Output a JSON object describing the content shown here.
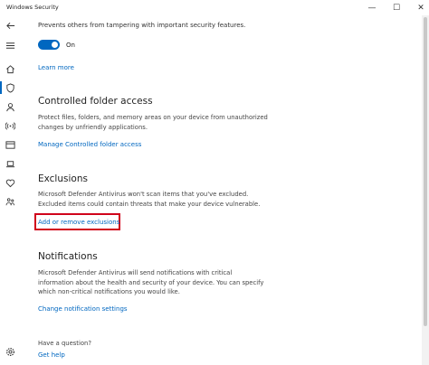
{
  "window": {
    "title": "Windows Security",
    "minimize": "—",
    "maximize": "☐",
    "close": "✕"
  },
  "tamper": {
    "text": "Prevents others from tampering with important security features.",
    "toggle_state": "On",
    "learn_more": "Learn more"
  },
  "controlled_folder": {
    "heading": "Controlled folder access",
    "line1": "Protect files, folders, and memory areas on your device from unauthorized",
    "line2": "changes by unfriendly applications.",
    "link": "Manage Controlled folder access"
  },
  "exclusions": {
    "heading": "Exclusions",
    "line1": "Microsoft Defender Antivirus won't scan items that you've excluded.",
    "line2": "Excluded items could contain threats that make your device vulnerable.",
    "link": "Add or remove exclusions"
  },
  "notifications": {
    "heading": "Notifications",
    "line1": "Microsoft Defender Antivirus will send notifications with critical",
    "line2": "information about the health and security of your device. You can specify",
    "line3": "which non-critical notifications you would like.",
    "link": "Change notification settings"
  },
  "help": {
    "question": "Have a question?",
    "link": "Get help"
  },
  "colors": {
    "accent": "#0067c0",
    "highlight": "#d0021b"
  },
  "rail_icons": [
    "back-arrow-icon",
    "hamburger-menu-icon",
    "home-icon",
    "shield-icon",
    "person-icon",
    "wifi-antenna-icon",
    "browser-window-icon",
    "laptop-icon",
    "heart-icon",
    "family-icon",
    "settings-gear-icon"
  ]
}
